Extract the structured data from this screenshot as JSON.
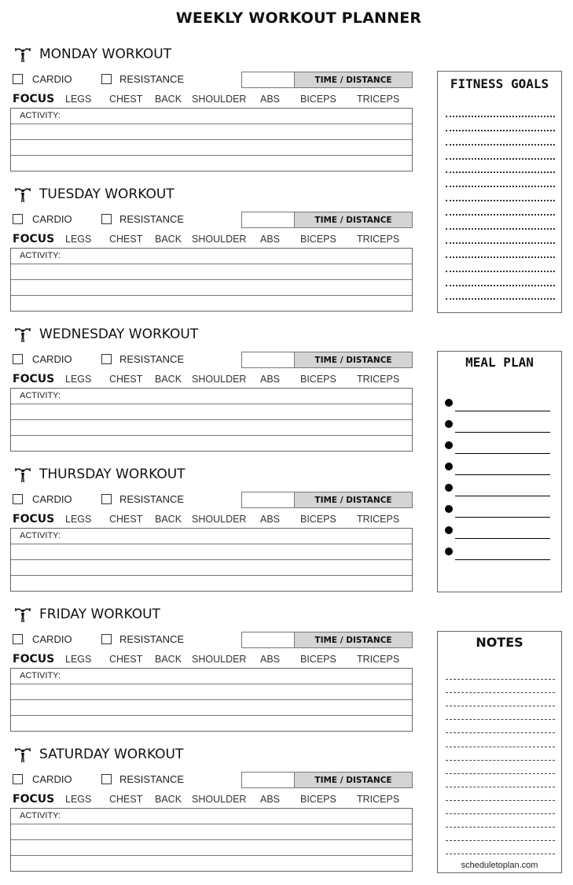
{
  "title": "WEEKLY WORKOUT PLANNER",
  "labels": {
    "cardio": "CARDIO",
    "resistance": "RESISTANCE",
    "time_distance": "TIME / DISTANCE",
    "focus": "FOCUS",
    "activity": "ACTIVITY:"
  },
  "focus_areas": [
    "LEGS",
    "CHEST",
    "BACK",
    "SHOULDER",
    "ABS",
    "BICEPS",
    "TRICEPS"
  ],
  "days": [
    {
      "name": "MONDAY WORKOUT",
      "icon": "weightlifter-icon"
    },
    {
      "name": "TUESDAY WORKOUT",
      "icon": "weightlifter-icon"
    },
    {
      "name": "WEDNESDAY WORKOUT",
      "icon": "weightlifter-icon"
    },
    {
      "name": "THURSDAY WORKOUT",
      "icon": "weightlifter-icon"
    },
    {
      "name": "FRIDAY WORKOUT",
      "icon": "weightlifter-icon"
    },
    {
      "name": "SATURDAY WORKOUT",
      "icon": "weightlifter-icon"
    }
  ],
  "sidebar": {
    "fitness_goals": {
      "title": "FITNESS GOALS",
      "line_count": 14
    },
    "meal_plan": {
      "title": "MEAL PLAN",
      "item_count": 8
    },
    "notes": {
      "title": "NOTES",
      "line_count": 14,
      "footer": "scheduletoplan.com"
    }
  }
}
